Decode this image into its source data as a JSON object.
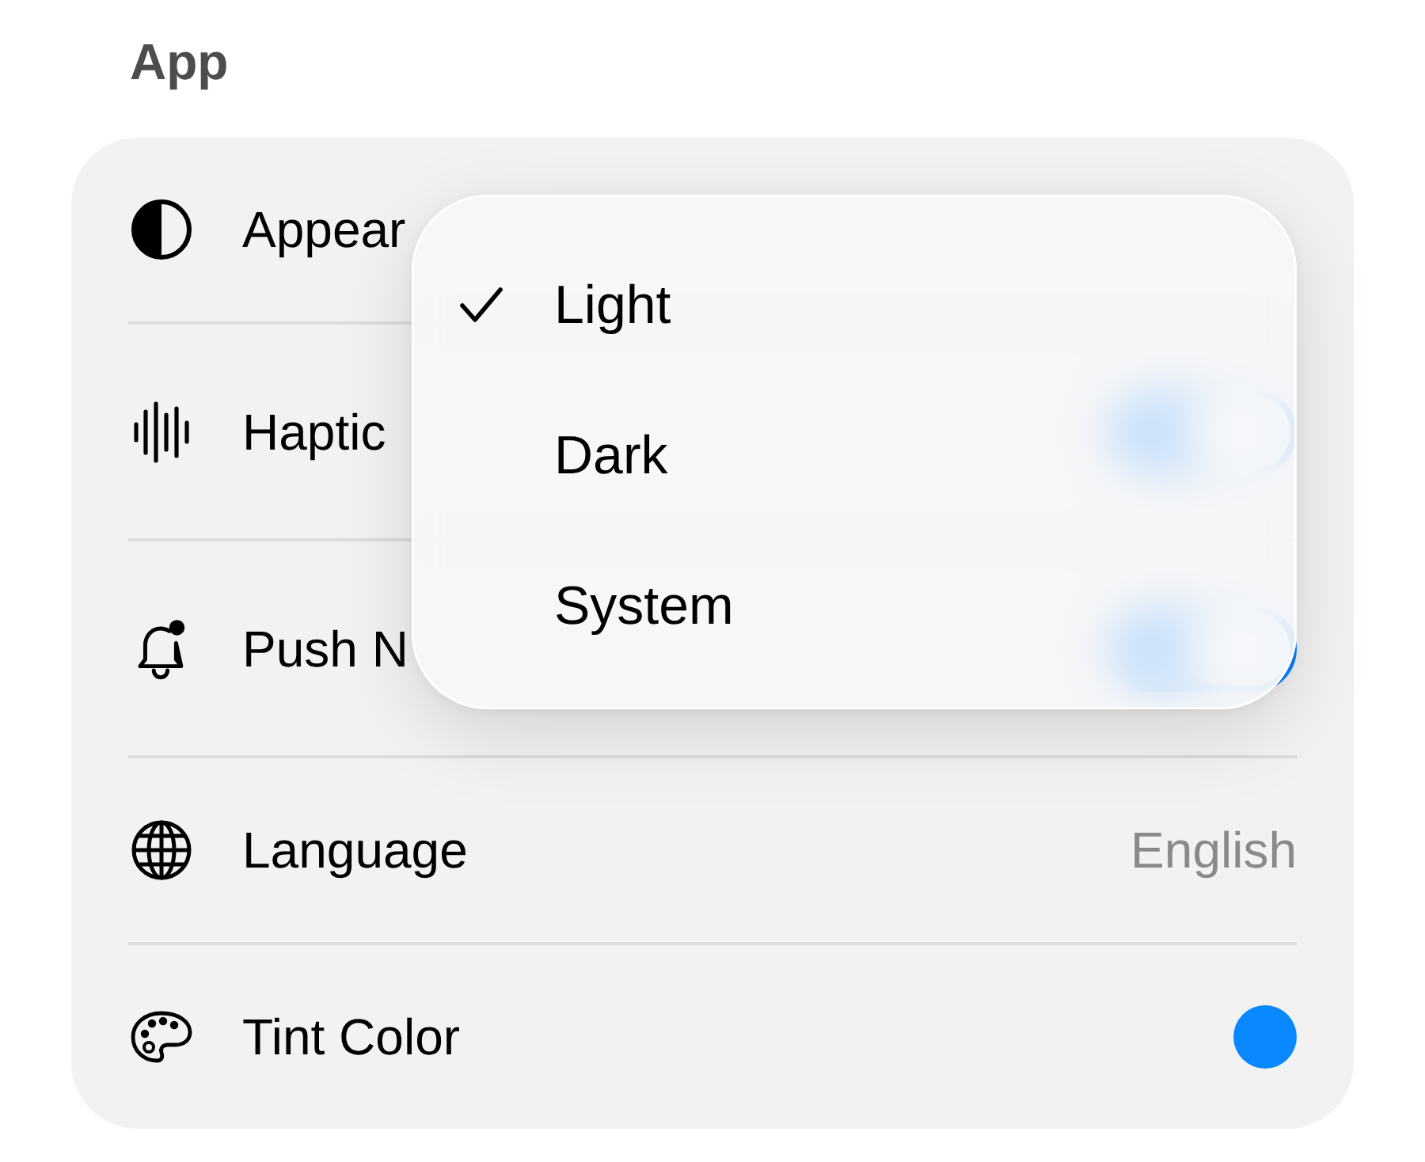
{
  "section": {
    "title": "App"
  },
  "rows": [
    {
      "kind": "picker",
      "label": "Appear"
    },
    {
      "kind": "toggle",
      "label": "Haptic",
      "on": true
    },
    {
      "kind": "toggle",
      "label": "Push N",
      "on": true
    },
    {
      "kind": "value",
      "label": "Language",
      "value": "English"
    },
    {
      "kind": "color",
      "label": "Tint Color",
      "color": "#0a88ff"
    }
  ],
  "menu": {
    "items": [
      {
        "label": "Light",
        "selected": true
      },
      {
        "label": "Dark",
        "selected": false
      },
      {
        "label": "System",
        "selected": false
      }
    ]
  }
}
